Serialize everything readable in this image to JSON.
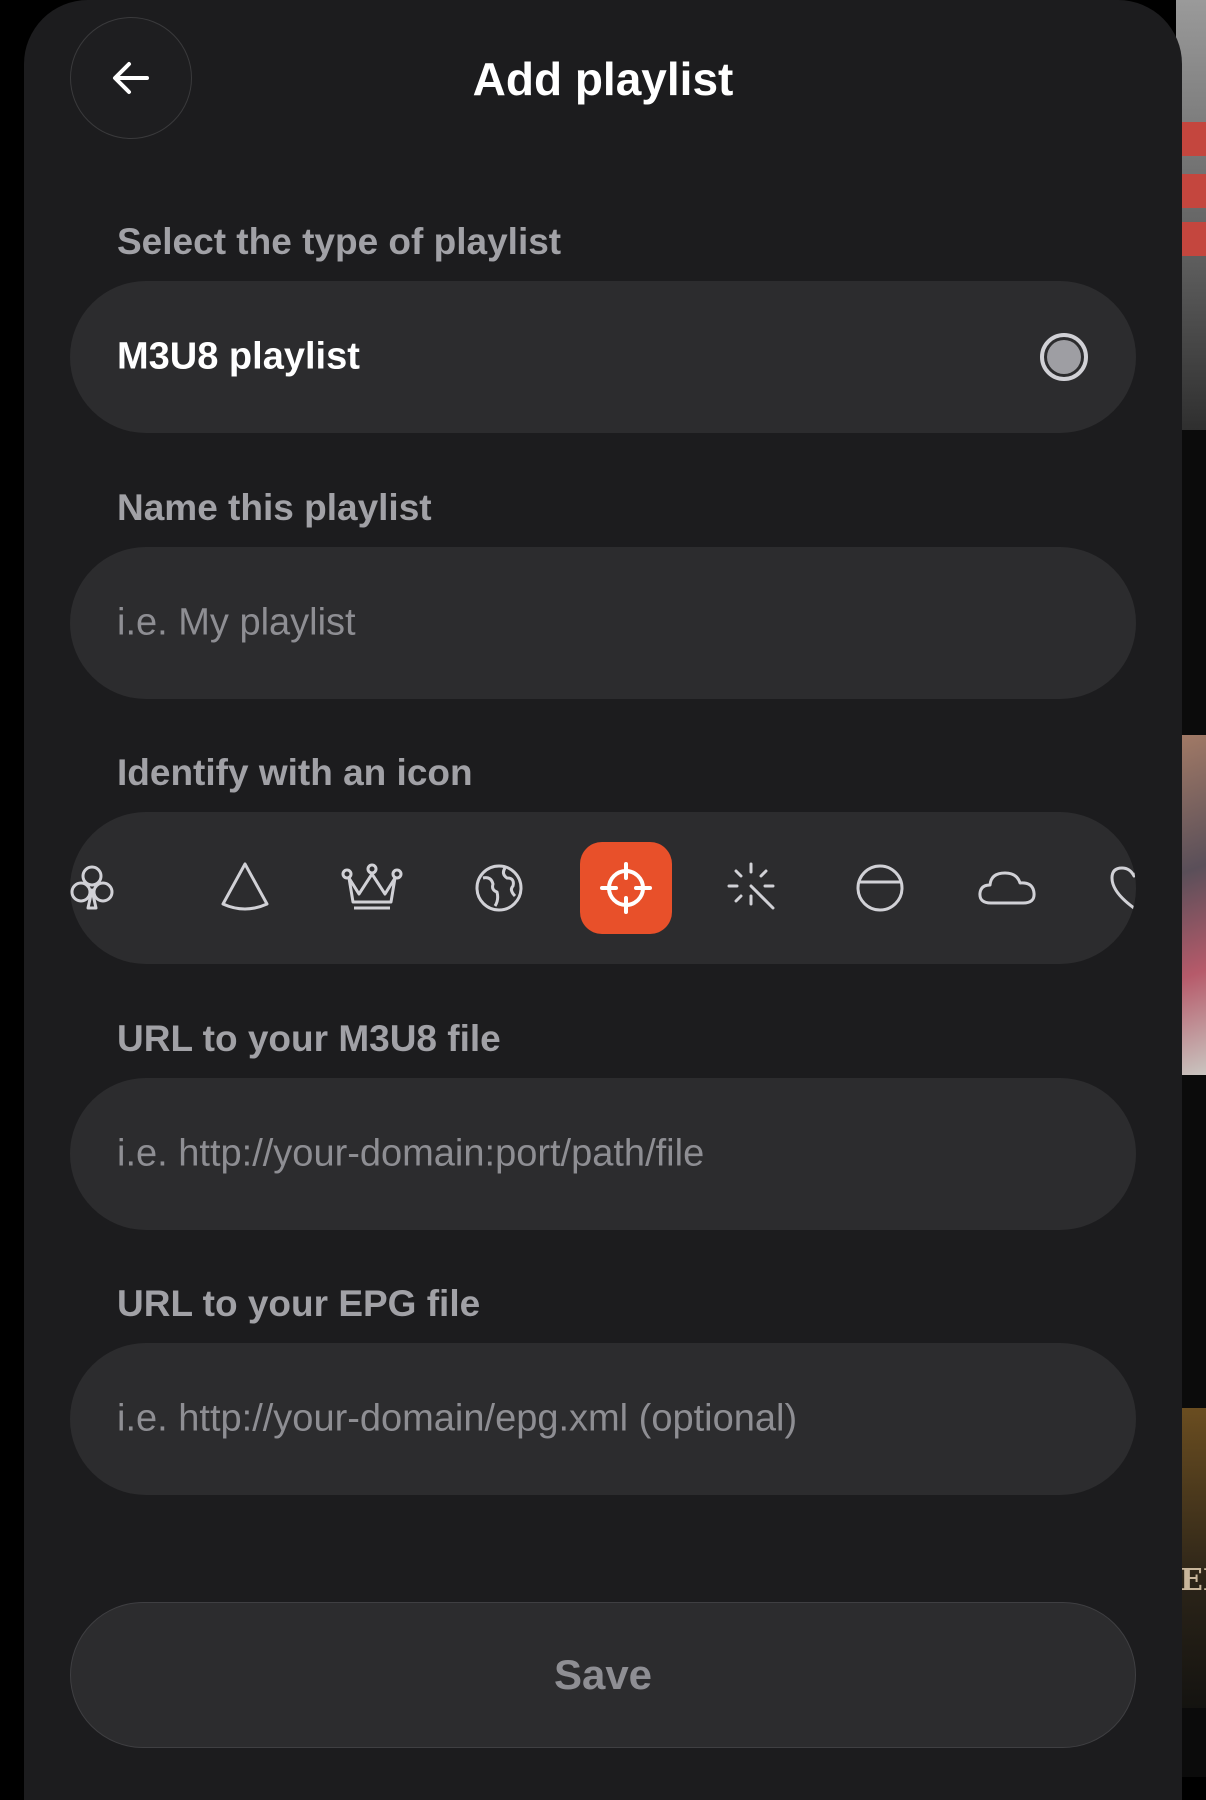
{
  "header": {
    "title": "Add playlist"
  },
  "type_section": {
    "label": "Select the type of playlist",
    "selected_value": "M3U8 playlist"
  },
  "name_section": {
    "label": "Name this playlist",
    "placeholder": "i.e. My playlist"
  },
  "icon_section": {
    "label": "Identify with an icon",
    "icons": [
      "club-icon",
      "cone-icon",
      "crown-icon",
      "globe-icon",
      "crosshair-icon",
      "magic-wand-icon",
      "half-circle-icon",
      "cloud-icon",
      "heart-icon"
    ],
    "selected_icon": "crosshair-icon",
    "accent_color": "#e8502a"
  },
  "m3u8_section": {
    "label": "URL to your M3U8 file",
    "placeholder": "i.e. http://your-domain:port/path/file"
  },
  "epg_section": {
    "label": "URL to your EPG file",
    "placeholder": "i.e. http://your-domain/epg.xml (optional)"
  },
  "save_button": {
    "label": "Save"
  },
  "background_partial_text": "EN"
}
